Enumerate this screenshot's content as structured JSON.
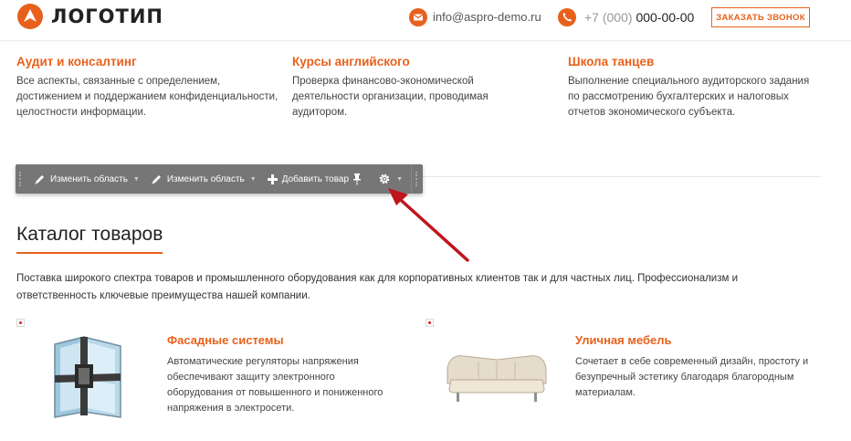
{
  "header": {
    "logo_text": "ЛОГОТИП",
    "email": "info@aspro-demo.ru",
    "phone_prefix": "+7 (000)",
    "phone_number": "000-00-00",
    "call_button": "ЗАКАЗАТЬ ЗВОНОК"
  },
  "services": [
    {
      "title": "Аудит и консалтинг",
      "text": "Все аспекты, связанные с определением, достижением и поддержанием конфиденциальности, целостности информации."
    },
    {
      "title": "Курсы английского",
      "text": "Проверка финансово-экономической деятельности организации, проводимая аудитором."
    },
    {
      "title": "Школа танцев",
      "text": "Выполнение специального аудиторского задания по рассмотрению бухгалтерских и налоговых отчетов экономического субъекта."
    }
  ],
  "toolbar": {
    "edit_area_1": "Изменить область",
    "edit_area_2": "Изменить область",
    "add_product": "Добавить товар"
  },
  "catalog": {
    "title": "Каталог товаров",
    "description": "Поставка широкого спектра товаров и промышленного оборудования как для корпоративных клиентов так и для частных лиц. Профессионализм и ответственность ключевые преимущества нашей компании.",
    "products": [
      {
        "title": "Фасадные системы",
        "text": "Автоматические регуляторы напряжения обеспечивают защиту электронного оборудования от повышенного и пониженного напряжения в электросети."
      },
      {
        "title": "Уличная мебель",
        "text": "Сочетает в себе современный дизайн, простоту и безупречный эстетику благодаря благородным материалам."
      }
    ]
  },
  "colors": {
    "accent": "#e8611c",
    "toolbar": "#767676",
    "arrow": "#c0151c"
  }
}
